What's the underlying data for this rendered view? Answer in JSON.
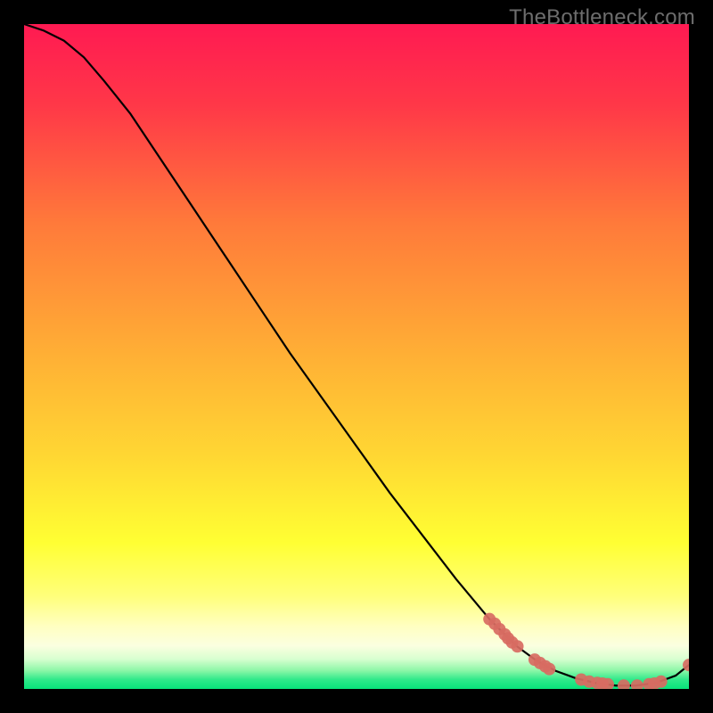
{
  "watermark": "TheBottleneck.com",
  "chart_data": {
    "type": "line",
    "title": "",
    "xlabel": "",
    "ylabel": "",
    "xlim": [
      0,
      100
    ],
    "ylim": [
      0,
      100
    ],
    "grid": false,
    "legend": false,
    "background_gradient": {
      "top": "#ff1a52",
      "mid_upper": "#ff7a3a",
      "mid": "#ffd733",
      "lower": "#ffff33",
      "pale_band": "#fbffe0",
      "bottom": "#08e27a"
    },
    "series": [
      {
        "name": "curve",
        "color": "#000000",
        "x": [
          0,
          3,
          6,
          9,
          12,
          16,
          20,
          25,
          30,
          35,
          40,
          45,
          50,
          55,
          60,
          65,
          70,
          74,
          77,
          80,
          83,
          86,
          89,
          92,
          95,
          98,
          100
        ],
        "y": [
          100,
          99,
          97.5,
          95,
          91.5,
          86.5,
          80.5,
          73,
          65.5,
          58,
          50.5,
          43.5,
          36.5,
          29.5,
          23,
          16.5,
          10.5,
          6.5,
          4.3,
          2.7,
          1.6,
          0.9,
          0.5,
          0.5,
          0.9,
          2.0,
          3.6
        ]
      }
    ],
    "markers": {
      "name": "points",
      "color": "#d86b62",
      "radius": 7,
      "points": [
        {
          "x": 70.0,
          "y": 10.5
        },
        {
          "x": 70.8,
          "y": 9.8
        },
        {
          "x": 71.5,
          "y": 9.0
        },
        {
          "x": 72.3,
          "y": 8.2
        },
        {
          "x": 72.8,
          "y": 7.6
        },
        {
          "x": 73.4,
          "y": 7.0
        },
        {
          "x": 74.2,
          "y": 6.4
        },
        {
          "x": 76.8,
          "y": 4.4
        },
        {
          "x": 77.6,
          "y": 3.9
        },
        {
          "x": 78.4,
          "y": 3.4
        },
        {
          "x": 79.0,
          "y": 3.0
        },
        {
          "x": 83.8,
          "y": 1.4
        },
        {
          "x": 85.0,
          "y": 1.1
        },
        {
          "x": 86.2,
          "y": 0.9
        },
        {
          "x": 87.0,
          "y": 0.8
        },
        {
          "x": 87.8,
          "y": 0.7
        },
        {
          "x": 90.2,
          "y": 0.5
        },
        {
          "x": 92.2,
          "y": 0.5
        },
        {
          "x": 94.0,
          "y": 0.7
        },
        {
          "x": 94.8,
          "y": 0.8
        },
        {
          "x": 95.8,
          "y": 1.1
        },
        {
          "x": 100.0,
          "y": 3.6
        }
      ]
    }
  }
}
